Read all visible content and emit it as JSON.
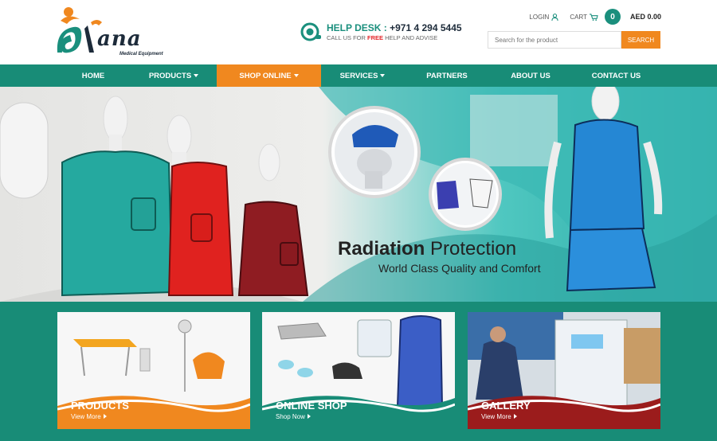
{
  "logo": {
    "text": "ana",
    "subtitle": "Medical Equipment"
  },
  "helpdesk": {
    "title_prefix": "HELP DESK : ",
    "phone": "+971 4 294 5445",
    "sub_prefix": "CALL US FOR ",
    "sub_free": "FREE",
    "sub_suffix": " HELP AND ADVISE"
  },
  "toplinks": {
    "login": "LOGIN",
    "cart": "CART",
    "cart_count": "0",
    "amount": "AED 0.00"
  },
  "search": {
    "placeholder": "Search for the product",
    "button": "SEARCH"
  },
  "nav": [
    {
      "label": "HOME",
      "dropdown": false
    },
    {
      "label": "PRODUCTS",
      "dropdown": true
    },
    {
      "label": "SHOP ONLINE",
      "dropdown": true,
      "active": true
    },
    {
      "label": "SERVICES",
      "dropdown": true
    },
    {
      "label": "PARTNERS",
      "dropdown": false
    },
    {
      "label": "ABOUT US",
      "dropdown": false
    },
    {
      "label": "CONTACT US",
      "dropdown": false
    }
  ],
  "banner": {
    "title_bold": "Radiation",
    "title_rest": " Protection",
    "subtitle": "World Class Quality and Comfort"
  },
  "cards": [
    {
      "title": "PRODUCTS",
      "link": "View More",
      "accent": "#f0881f"
    },
    {
      "title": "ONLINE SHOP",
      "link": "Shop Now",
      "accent": "#188c77"
    },
    {
      "title": "GALLERY",
      "link": "View More",
      "accent": "#9b1c1c"
    }
  ],
  "colors": {
    "brand": "#188c77",
    "accent": "#f0881f",
    "dark": "#1d2b3a"
  }
}
